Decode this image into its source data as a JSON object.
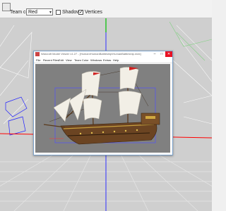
{
  "toolbar": {
    "team_color_label": "Team color",
    "team_color_value": "Red",
    "shadows_label": "Shadows",
    "vertices_label": "Vertices",
    "shadows_checked": false,
    "vertices_checked": true
  },
  "subwindow": {
    "title": "Warcraft Model Viewer v1.27 - [Human\\HumanBattleship\\HumanBattleship.mdx]",
    "menu": [
      "File",
      "Recent Files",
      "Edit",
      "View",
      "Team Color",
      "Windows",
      "Extras",
      "Help"
    ]
  },
  "colors": {
    "viewport_bg": "#cfcfcf",
    "axis_red": "#ff0000",
    "axis_blue": "#3030ff",
    "axis_green": "#00c000",
    "grid": "#e6e6e6",
    "close_button": "#e81123"
  },
  "icons": {
    "toolbar": "window-icon",
    "app": "app-icon",
    "minimize": "minimize-icon",
    "maximize": "maximize-icon",
    "close": "close-icon"
  }
}
